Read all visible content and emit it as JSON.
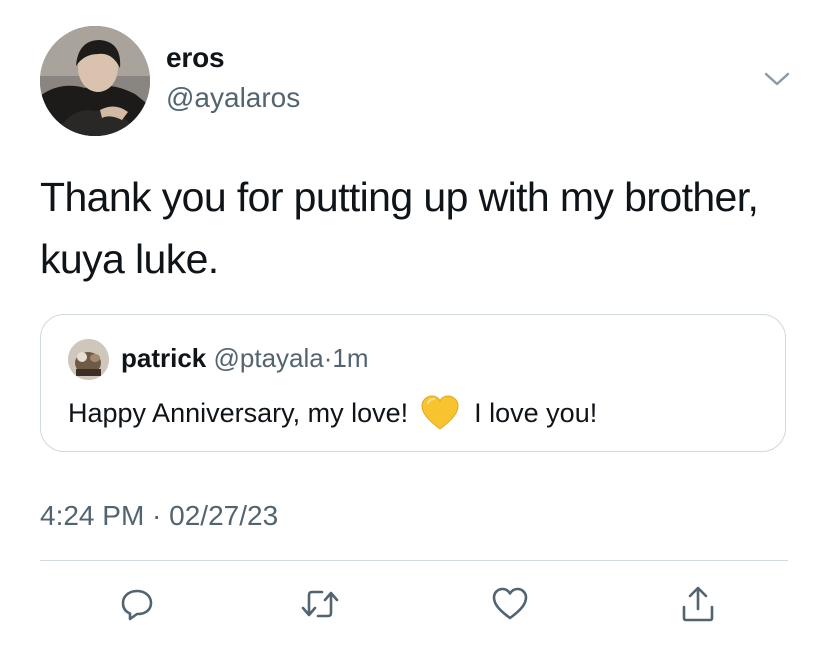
{
  "author": {
    "display_name": "eros",
    "handle": "@ayalaros",
    "avatar_icon": "profile-photo"
  },
  "more_icon": "chevron-down-icon",
  "tweet": {
    "text": "Thank you for putting up with my brother, kuya luke.",
    "timestamp": "4:24 PM · 02/27/23"
  },
  "quoted_tweet": {
    "display_name": "patrick",
    "handle": "@ptayala",
    "separator": "·",
    "time": "1m",
    "text_before": "Happy Anniversary, my love!",
    "emoji": "yellow-heart-emoji",
    "text_after": "I love you!"
  },
  "actions": [
    {
      "name": "reply",
      "icon": "reply-icon"
    },
    {
      "name": "retweet",
      "icon": "retweet-icon"
    },
    {
      "name": "like",
      "icon": "heart-icon"
    },
    {
      "name": "share",
      "icon": "share-icon"
    }
  ],
  "colors": {
    "text_primary": "#0f1419",
    "text_secondary": "#536471",
    "border": "#cfd9de",
    "emoji_heart": "#f7c32e"
  }
}
